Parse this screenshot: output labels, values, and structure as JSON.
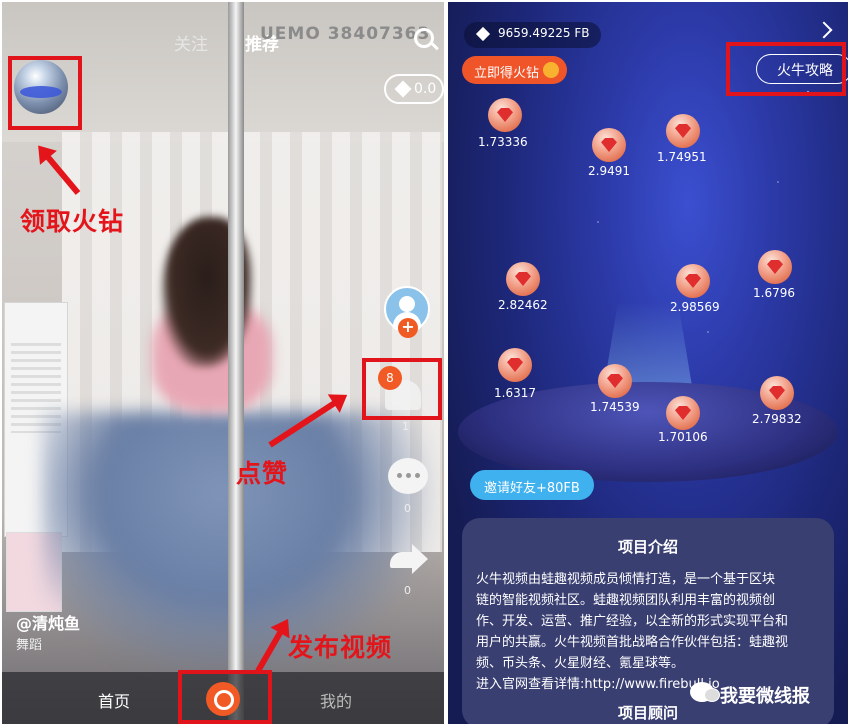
{
  "left": {
    "tabs": {
      "follow": "关注",
      "recommend": "推荐"
    },
    "user_id": "UEMO 38407363",
    "fb_pill": "0.0",
    "like_badge": "8",
    "like_count": "1",
    "comment_count": "0",
    "share_count": "0",
    "username": "@清炖鱼",
    "tag": "舞蹈",
    "nav": {
      "home": "首页",
      "me": "我的"
    },
    "annotations": {
      "claim": "领取火钻",
      "like": "点赞",
      "publish": "发布视频"
    },
    "colors": {
      "annotation": "#e4141b",
      "accent": "#f15a24"
    }
  },
  "right": {
    "balance": "9659.49225 FB",
    "get_button": "立即得火钻",
    "guide_button": "火牛攻略",
    "diamonds": [
      "1.73336",
      "2.9491",
      "1.74951",
      "2.82462",
      "2.98569",
      "1.6796",
      "1.6317",
      "1.74539",
      "2.79832",
      "1.70106"
    ],
    "invite_button": "邀请好友+80FB",
    "intro": {
      "title": "项目介绍",
      "line1": "火牛视频由蛙趣视频成员倾情打造，是一个基于区块",
      "line2": "链的智能视频社区。蛙趣视频团队利用丰富的视频创",
      "line3": "作、开发、运营、推广经验，以全新的形式实现平台和",
      "line4": "用户的共赢。火牛视频首批战略合作伙伴包括：蛙趣视",
      "line5": "频、币头条、火星财经、氪星球等。",
      "line6": "进入官网查看详情:http://www.firebull.io",
      "advisor_title": "项目顾问"
    },
    "watermark": "我要微线报"
  }
}
